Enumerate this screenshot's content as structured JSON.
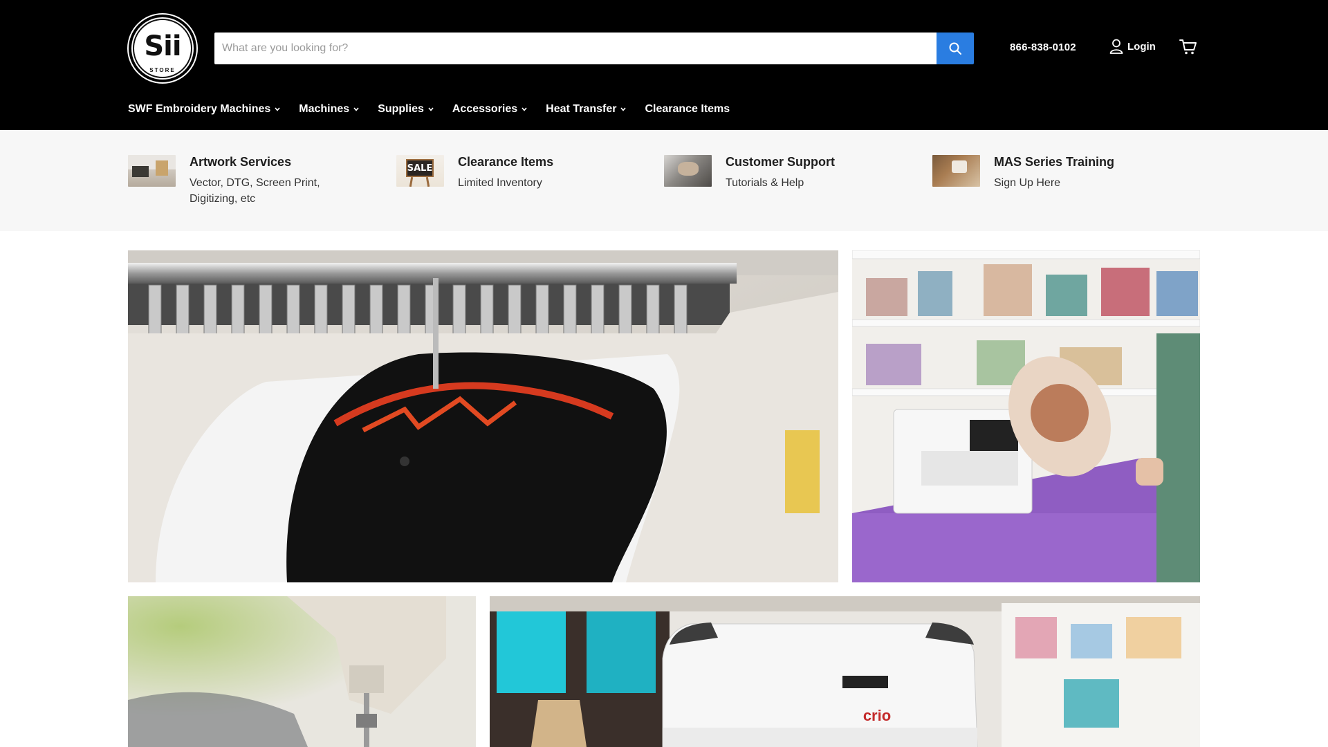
{
  "header": {
    "logo_text": "Sii",
    "logo_subtext": "STORE",
    "search": {
      "placeholder": "What are you looking for?",
      "value": ""
    },
    "phone": "866-838-0102",
    "login_label": "Login",
    "icons": {
      "search": "search-icon",
      "user": "user-icon",
      "cart": "cart-icon"
    },
    "accent_color": "#2a7de1"
  },
  "nav": {
    "items": [
      {
        "label": "SWF Embroidery Machines",
        "has_dropdown": true
      },
      {
        "label": "Machines",
        "has_dropdown": true
      },
      {
        "label": "Supplies",
        "has_dropdown": true
      },
      {
        "label": "Accessories",
        "has_dropdown": true
      },
      {
        "label": "Heat Transfer",
        "has_dropdown": true
      },
      {
        "label": "Clearance Items",
        "has_dropdown": false
      }
    ]
  },
  "promos": [
    {
      "title": "Artwork Services",
      "subtitle": "Vector, DTG, Screen Print, Digitizing, etc"
    },
    {
      "title": "Clearance Items",
      "subtitle": "Limited Inventory",
      "thumb_text": "SALE"
    },
    {
      "title": "Customer Support",
      "subtitle": "Tutorials & Help"
    },
    {
      "title": "MAS Series Training",
      "subtitle": "Sign Up Here"
    }
  ],
  "banners": {
    "printer_brand_text": "crio"
  }
}
